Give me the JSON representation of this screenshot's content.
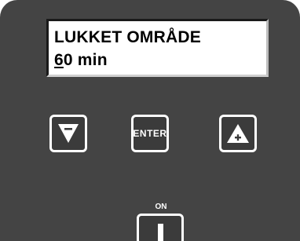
{
  "display": {
    "line1": "LUKKET OMRÅDE",
    "line2_cursor": "6",
    "line2_rest": "0 min"
  },
  "keys": {
    "down": {
      "symbol": "−",
      "icon": "triangle-down-minus-icon"
    },
    "enter": {
      "label": "ENTER"
    },
    "up": {
      "symbol": "+",
      "icon": "triangle-up-plus-icon"
    }
  },
  "power": {
    "label": "ON",
    "icon": "power-switch-icon"
  },
  "colors": {
    "panel": "#444444",
    "display_bg": "#ffffff",
    "key_border": "#ffffff"
  }
}
